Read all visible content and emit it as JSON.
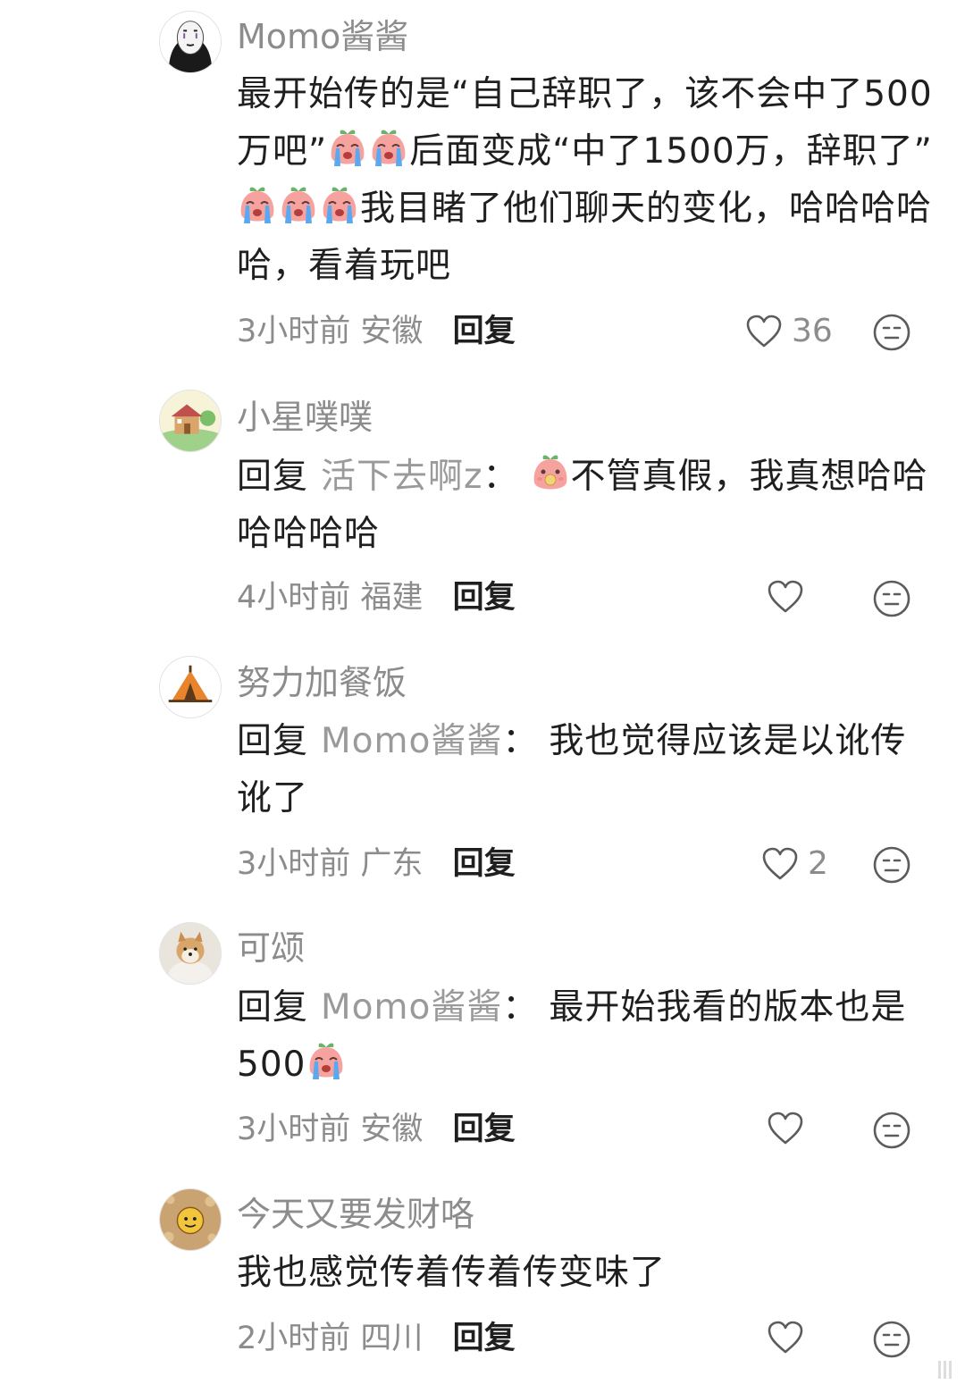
{
  "comments": [
    {
      "username": "Momo酱酱",
      "avatar_icon": "no-face-mask-avatar",
      "text_1": "最开始传的是“自己辞职了，该不会中了500万吧”",
      "text_2": "后面变成“中了1500万，辞职了”",
      "text_3": "我目睹了他们聊天的变化，哈哈哈哈哈，看着玩吧",
      "time": "3小时前",
      "location": "安徽",
      "reply_label": "回复",
      "likes": "36"
    },
    {
      "username": "小星噗噗",
      "avatar_icon": "cartoon-house-avatar",
      "reply_prefix": "回复",
      "reply_target": "活下去啊z",
      "colon": "：",
      "text_1": "不管真假，我真想哈哈哈哈哈哈",
      "time": "4小时前",
      "location": "福建",
      "reply_label": "回复",
      "likes": ""
    },
    {
      "username": "努力加餐饭",
      "avatar_icon": "tent-avatar",
      "reply_prefix": "回复",
      "reply_target": "Momo酱酱",
      "colon": "：",
      "text_1": "我也觉得应该是以讹传讹了",
      "time": "3小时前",
      "location": "广东",
      "reply_label": "回复",
      "likes": "2"
    },
    {
      "username": "可颂",
      "avatar_icon": "shiba-dog-avatar",
      "reply_prefix": "回复",
      "reply_target": "Momo酱酱",
      "colon": "：",
      "text_1": "最开始我看的版本也是500",
      "time": "3小时前",
      "location": "安徽",
      "reply_label": "回复",
      "likes": ""
    },
    {
      "username": "今天又要发财咯",
      "avatar_icon": "cartoon-face-avatar",
      "text_1": "我也感觉传着传着传变味了",
      "time": "2小时前",
      "location": "四川",
      "reply_label": "回复",
      "likes": ""
    }
  ],
  "colors": {
    "username": "#8c8c8c",
    "body": "#1f1f1f",
    "meta": "#8c8c8c",
    "emoji_face": "#f6a3a0",
    "emoji_leaf": "#6bb36b",
    "emoji_tear": "#5aa9f0"
  },
  "emojis": {
    "crying": "crying-peach-emoji",
    "eating": "eating-peach-emoji"
  }
}
